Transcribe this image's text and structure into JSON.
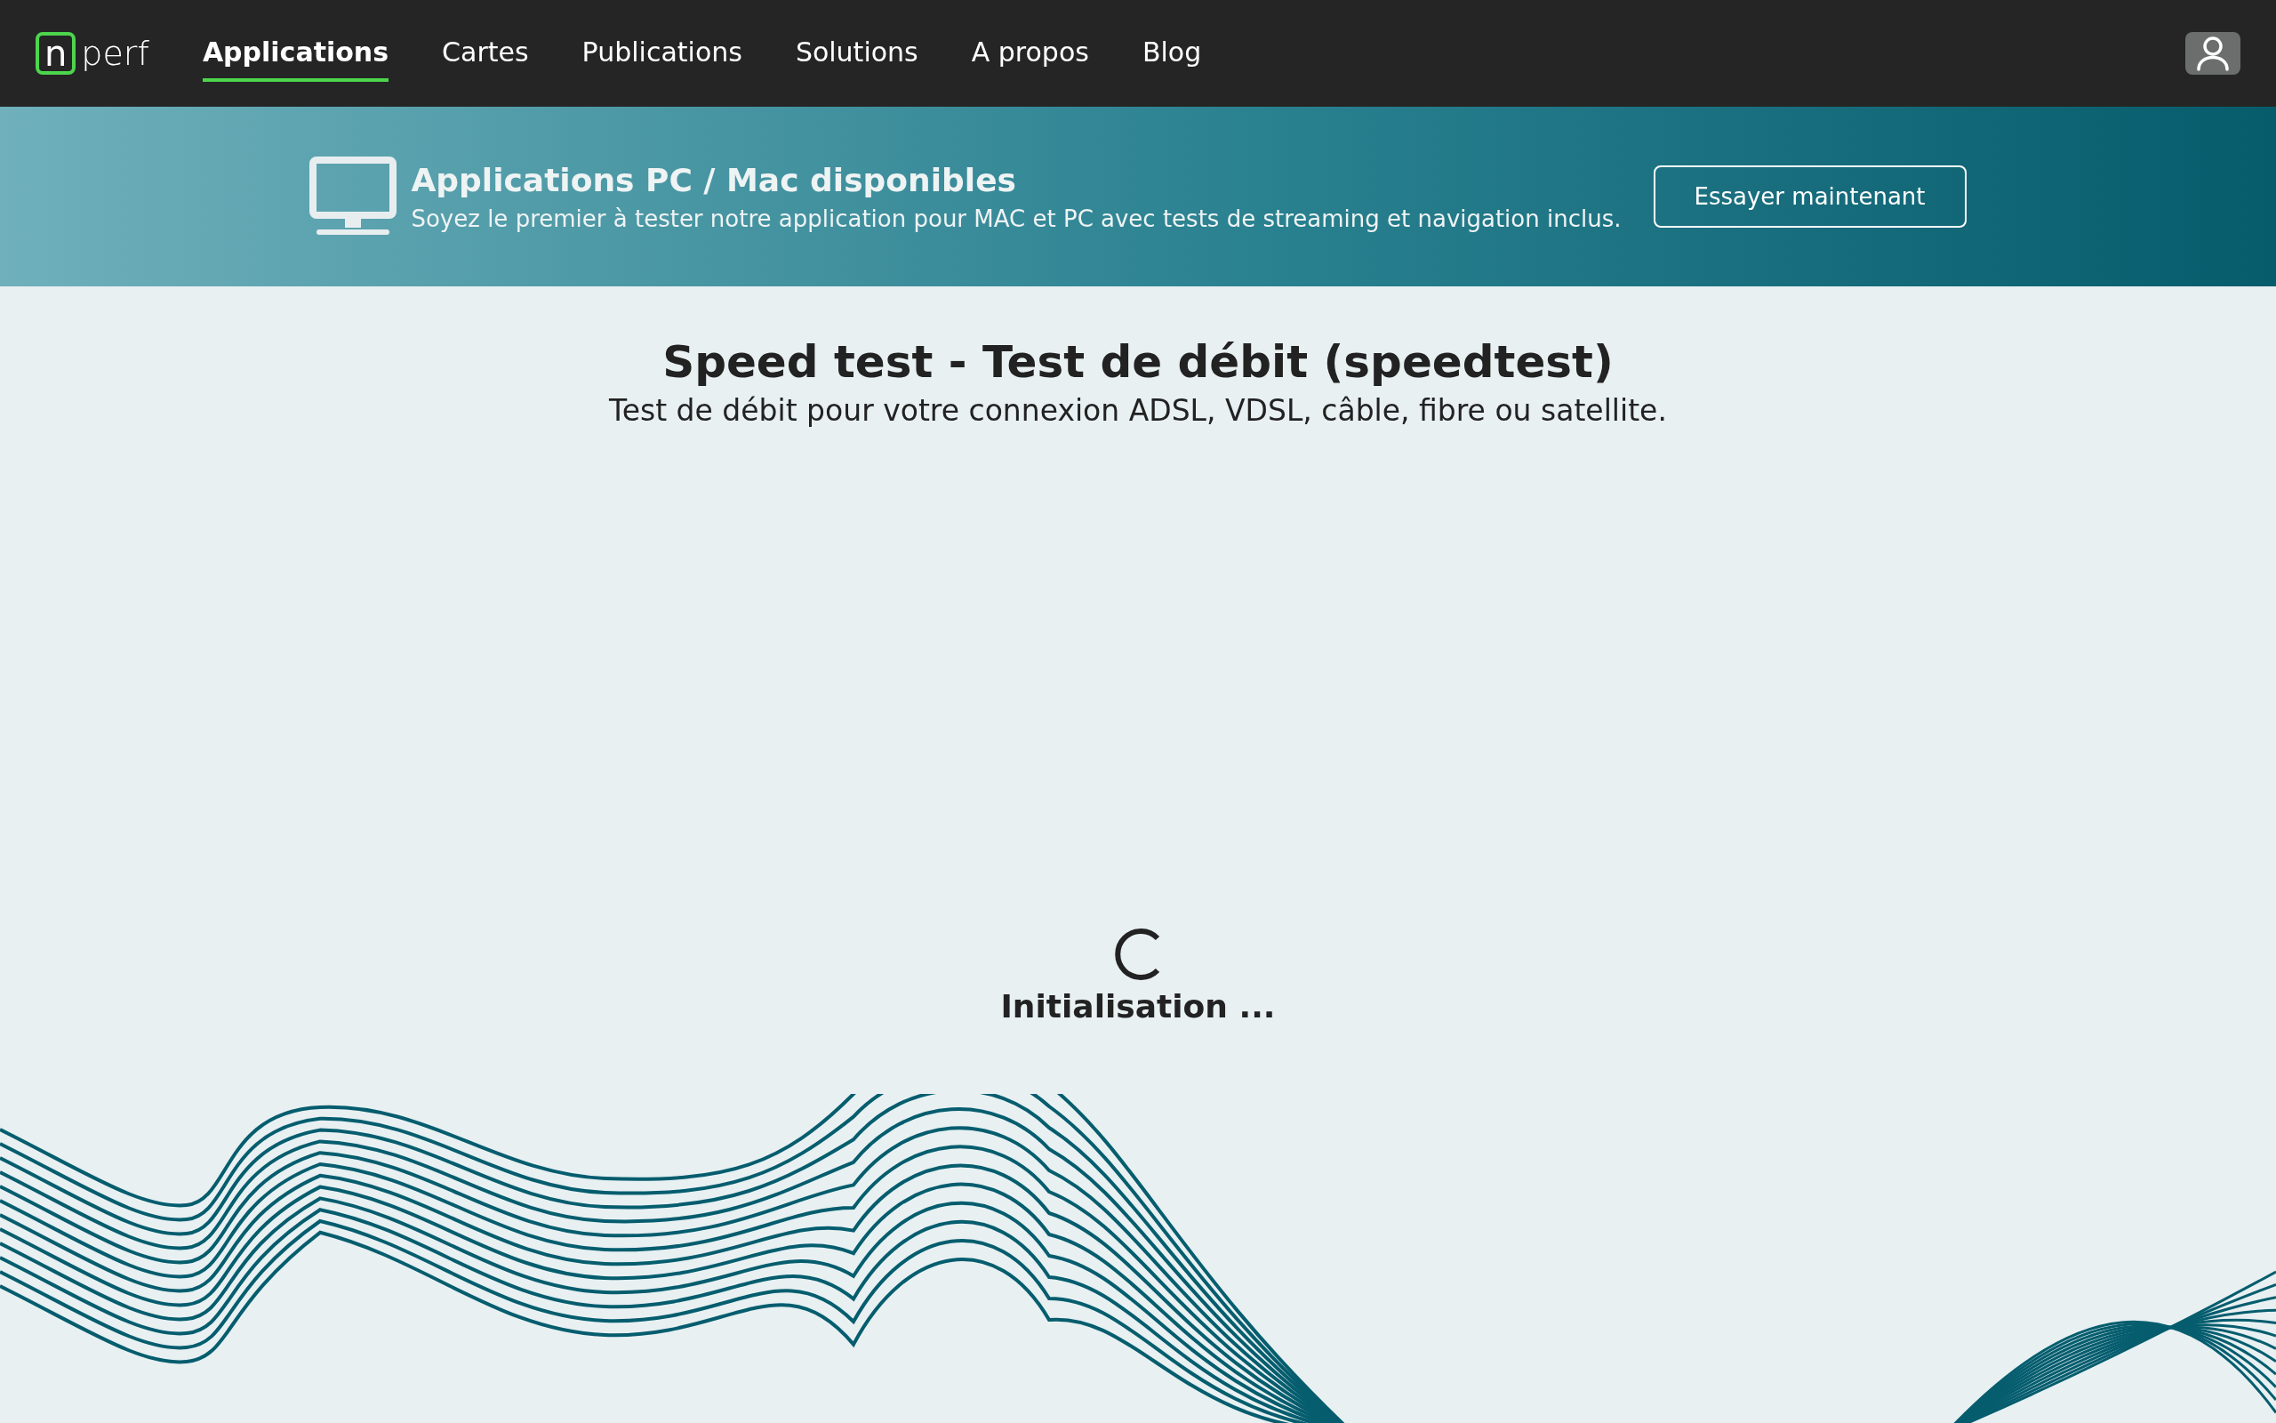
{
  "nav": {
    "logo": {
      "mark": "n",
      "text": "perf"
    },
    "items": [
      {
        "label": "Applications",
        "selected": true
      },
      {
        "label": "Cartes",
        "selected": false
      },
      {
        "label": "Publications",
        "selected": false
      },
      {
        "label": "Solutions",
        "selected": false
      },
      {
        "label": "A propos",
        "selected": false
      },
      {
        "label": "Blog",
        "selected": false
      }
    ]
  },
  "banner": {
    "title": "Applications PC / Mac disponibles",
    "text": "Soyez le premier à tester notre application pour MAC et PC avec tests de streaming et navigation inclus.",
    "button": "Essayer maintenant"
  },
  "header": {
    "title": "Speed test - Test de débit (speedtest)",
    "subtitle": "Test de débit pour votre connexion ADSL, VDSL, câble, fibre ou satellite."
  },
  "status": {
    "label": "Initialisation ..."
  }
}
